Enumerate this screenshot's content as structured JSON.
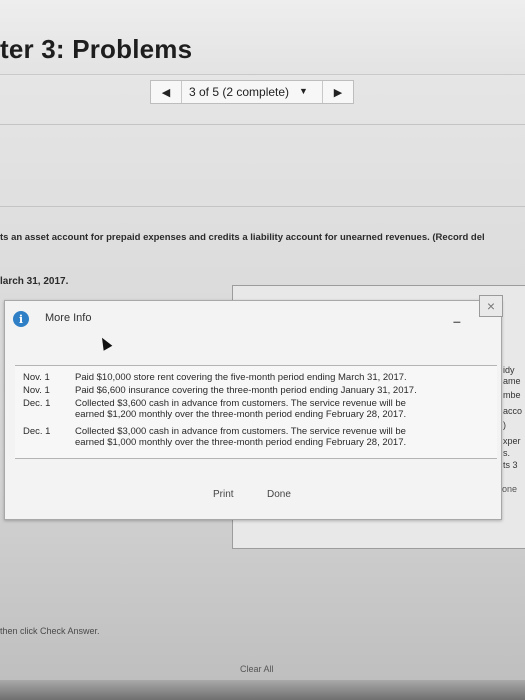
{
  "header": {
    "chapter_title": "ter 3: Problems"
  },
  "pager": {
    "label": "3 of 5 (2 complete)",
    "prev_glyph": "◀",
    "dropdown_glyph": "▼",
    "next_glyph": "▶"
  },
  "main": {
    "instructions": "ts an asset account for prepaid expenses and credits a liability account for unearned revenues. (Record del",
    "date_line": "larch 31, 2017.",
    "bg_side": [
      "idy",
      "ame",
      "mbe",
      "acco",
      ")",
      "xper",
      "s.",
      "ts 3"
    ],
    "bg_done": "one",
    "footer_text": "then click Check Answer.",
    "clear_all": "Clear All"
  },
  "modal": {
    "title": "More Info",
    "info_icon": "i",
    "minimize_glyph": "–",
    "close_glyph": "×",
    "rows": [
      {
        "date": "Nov. 1",
        "lines": [
          "Paid $10,000 store rent covering the five-month period ending March 31, 2017."
        ]
      },
      {
        "date": "Nov. 1",
        "lines": [
          "Paid $6,600 insurance covering the three-month period ending January 31, 2017."
        ]
      },
      {
        "date": "Dec. 1",
        "lines": [
          "Collected $3,600 cash in advance from customers. The service revenue will be",
          "earned $1,200 monthly over the three-month period ending February 28, 2017."
        ]
      },
      {
        "date": "Dec. 1",
        "lines": [
          "Collected $3,000 cash in advance from customers. The service revenue will be",
          "earned $1,000 monthly over the three-month period ending February 28, 2017."
        ]
      }
    ],
    "print_label": "Print",
    "done_label": "Done"
  },
  "icons": {
    "info": "info-icon",
    "cursor": "cursor-icon"
  },
  "colors": {
    "info_blue": "#2e7fc6"
  }
}
